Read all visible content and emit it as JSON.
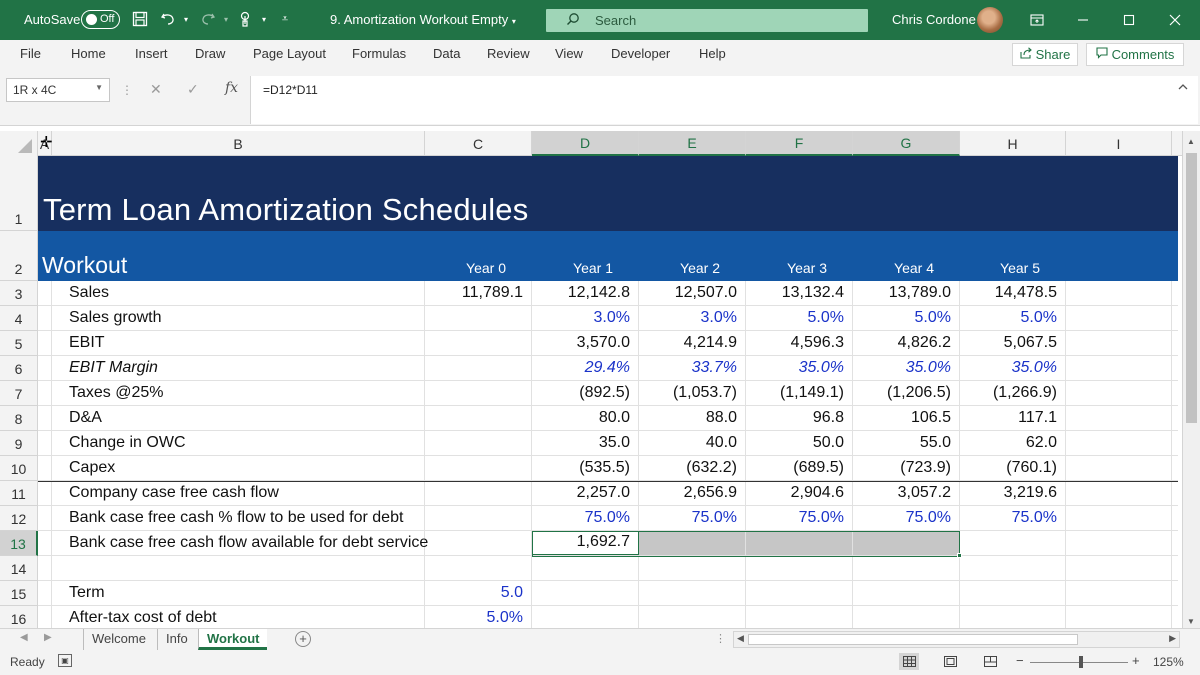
{
  "titlebar": {
    "autosave_label": "AutoSave",
    "autosave_state": "Off",
    "file_title": "9. Amortization Workout Empty",
    "search_placeholder": "Search",
    "user_name": "Chris Cordone"
  },
  "menu": {
    "items": [
      "File",
      "Home",
      "Insert",
      "Draw",
      "Page Layout",
      "Formulas",
      "Data",
      "Review",
      "View",
      "Developer",
      "Help"
    ],
    "share_label": "Share",
    "comments_label": "Comments"
  },
  "formula_bar": {
    "name_box": "1R x 4C",
    "fx_label": "fx",
    "formula": "=D12*D11"
  },
  "sheet": {
    "columns": [
      "A",
      "B",
      "C",
      "D",
      "E",
      "F",
      "G",
      "H",
      "I"
    ],
    "selected_columns": [
      "D",
      "E",
      "F",
      "G"
    ],
    "row_numbers": [
      "1",
      "2",
      "3",
      "4",
      "5",
      "6",
      "7",
      "8",
      "9",
      "10",
      "11",
      "12",
      "13",
      "14",
      "15",
      "16"
    ],
    "selected_row": "13",
    "title": "Term Loan Amortization Schedules",
    "subtitle": "Workout",
    "year_headers": [
      "Year 0",
      "Year 1",
      "Year 2",
      "Year 3",
      "Year 4",
      "Year 5"
    ],
    "rows": [
      {
        "label": "Sales",
        "values": [
          "11,789.1",
          "12,142.8",
          "12,507.0",
          "13,132.4",
          "13,789.0",
          "14,478.5"
        ]
      },
      {
        "label": "Sales growth",
        "values": [
          "",
          "3.0%",
          "3.0%",
          "5.0%",
          "5.0%",
          "5.0%"
        ]
      },
      {
        "label": "EBIT",
        "values": [
          "",
          "3,570.0",
          "4,214.9",
          "4,596.3",
          "4,826.2",
          "5,067.5"
        ]
      },
      {
        "label": "EBIT Margin",
        "values": [
          "",
          "29.4%",
          "33.7%",
          "35.0%",
          "35.0%",
          "35.0%"
        ]
      },
      {
        "label": "Taxes @25%",
        "values": [
          "",
          "(892.5)",
          "(1,053.7)",
          "(1,149.1)",
          "(1,206.5)",
          "(1,266.9)"
        ]
      },
      {
        "label": "D&A",
        "values": [
          "",
          "80.0",
          "88.0",
          "96.8",
          "106.5",
          "117.1"
        ]
      },
      {
        "label": "Change in OWC",
        "values": [
          "",
          "35.0",
          "40.0",
          "50.0",
          "55.0",
          "62.0"
        ]
      },
      {
        "label": "Capex",
        "values": [
          "",
          "(535.5)",
          "(632.2)",
          "(689.5)",
          "(723.9)",
          "(760.1)"
        ]
      },
      {
        "label": "Company case free cash flow",
        "values": [
          "",
          "2,257.0",
          "2,656.9",
          "2,904.6",
          "3,057.2",
          "3,219.6"
        ]
      },
      {
        "label": "Bank case free cash % flow to be used for debt",
        "values": [
          "",
          "75.0%",
          "75.0%",
          "75.0%",
          "75.0%",
          "75.0%"
        ]
      },
      {
        "label": "Bank case free cash flow available for debt service",
        "values": [
          "",
          "1,692.7",
          "",
          "",
          "",
          ""
        ]
      },
      {
        "label": "",
        "values": [
          "",
          "",
          "",
          "",
          "",
          ""
        ]
      },
      {
        "label": "Term",
        "values": [
          "5.0",
          "",
          "",
          "",
          "",
          ""
        ]
      },
      {
        "label": "After-tax cost of debt",
        "values": [
          "5.0%",
          "",
          "",
          "",
          "",
          ""
        ]
      }
    ]
  },
  "tabs": {
    "items": [
      "Welcome",
      "Info",
      "Workout"
    ],
    "active": "Workout"
  },
  "status": {
    "ready": "Ready",
    "zoom": "125%",
    "zoom_fraction": 0.52
  },
  "colors": {
    "accent": "#217346",
    "banner_dark": "#172f5f",
    "banner_blue": "#1357a3",
    "input_blue": "#1b33c9"
  }
}
